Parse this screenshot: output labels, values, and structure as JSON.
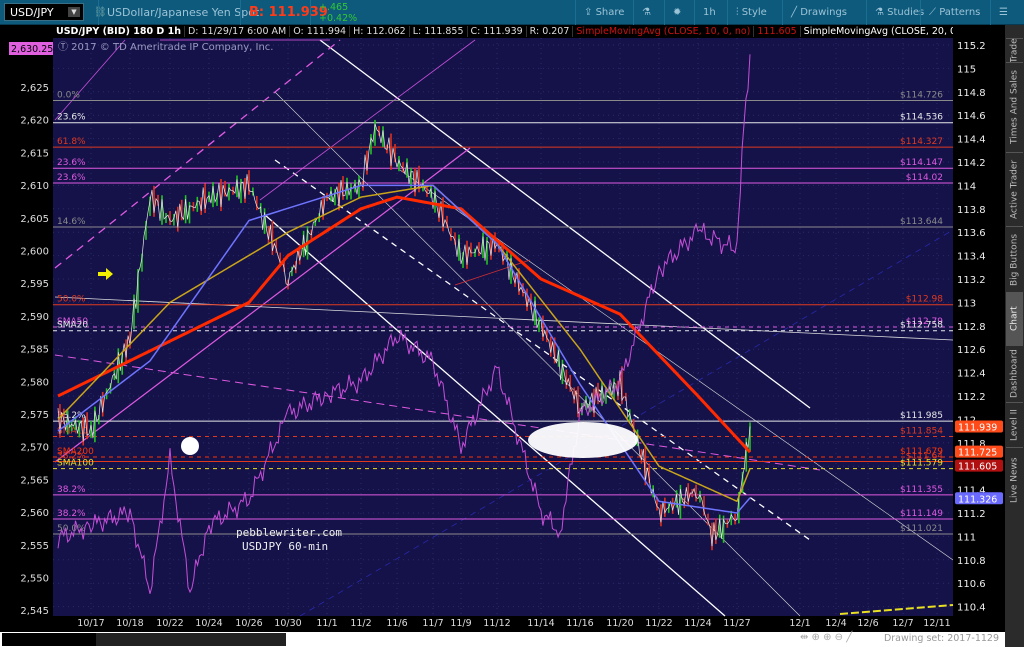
{
  "toolbar": {
    "symbol": "USD/JPY",
    "description": "USDollar/Japanese Yen Spot",
    "bid": "B: 111.939",
    "change": "+.465",
    "change_pct": "+0.42%",
    "share": "Share",
    "timeframe": "1h",
    "style": "Style",
    "drawings": "Drawings",
    "studies": "Studies",
    "patterns": "Patterns"
  },
  "info": {
    "title": "USD/JPY (BID) 180 D 1h",
    "date": "D: 11/29/17 6:00 AM",
    "open": "O: 111.994",
    "high": "H: 112.062",
    "low": "L: 111.855",
    "close": "C: 111.939",
    "range": "R: 0.207",
    "sma10_label": "SimpleMovingAvg (CLOSE, 10, 0, no)",
    "sma10_value": "111.605",
    "sma20_label": "SimpleMovingAvg (CLOSE, 20, 0, no)",
    "more": "..."
  },
  "copyright": "2017 © TD Ameritrade IP Company, Inc.",
  "annotation": [
    "pebblewriter.com",
    "USDJPY 60-min"
  ],
  "side_tabs": [
    "Trade",
    "Times And Sales",
    "Active Trader",
    "Big Buttons",
    "Chart",
    "Dashboard",
    "Level II",
    "Live News"
  ],
  "drawing_set": "Drawing set: 2017-1129",
  "colors": {
    "background": "#15124a",
    "toolbar": "#0e5a7c",
    "up": "#22c322",
    "down": "#e0301e",
    "spx": "#c44fd6",
    "sma_red": "#ff2a00",
    "sma_yellow": "#c9a419",
    "sma_blue": "#6f74ff",
    "sma_white": "#e8e8e8"
  },
  "chart_data": {
    "type": "line",
    "x_ticks": [
      "10/17",
      "10/18",
      "10/22",
      "10/24",
      "10/26",
      "10/30",
      "11/1",
      "11/2",
      "11/6",
      "11/7",
      "11/9",
      "11/12",
      "11/14",
      "11/16",
      "11/20",
      "11/22",
      "11/24",
      "11/27",
      "12/1",
      "12/4",
      "12/6",
      "12/7",
      "12/11"
    ],
    "right_axis": {
      "ticks": [
        "115.2",
        "115",
        "114.8",
        "114.6",
        "114.4",
        "114.2",
        "114",
        "113.8",
        "113.6",
        "113.4",
        "113.2",
        "113",
        "112.8",
        "112.6",
        "112.4",
        "112.2",
        "112",
        "111.8",
        "111.6",
        "111.4",
        "111.2",
        "111",
        "110.8",
        "110.6",
        "110.4"
      ],
      "range": [
        110.4,
        115.2
      ]
    },
    "left_axis": {
      "ticks": [
        "2,625",
        "2,620",
        "2,615",
        "2,610",
        "2,605",
        "2,600",
        "2,595",
        "2,590",
        "2,585",
        "2,580",
        "2,575",
        "2,570",
        "2,565",
        "2,560",
        "2,555",
        "2,550",
        "2,545"
      ],
      "range": [
        2545,
        2625
      ]
    },
    "series": [
      {
        "name": "USD/JPY",
        "axis": "right",
        "x": [
          "10/16",
          "10/17",
          "10/18",
          "10/19",
          "10/22",
          "10/24",
          "10/26",
          "10/30",
          "11/1",
          "11/2",
          "11/3",
          "11/6",
          "11/7",
          "11/9",
          "11/12",
          "11/14",
          "11/16",
          "11/20",
          "11/22",
          "11/24",
          "11/26",
          "11/27",
          "11/29"
        ],
        "values": [
          112.0,
          111.9,
          112.7,
          113.9,
          113.7,
          113.9,
          114.0,
          113.2,
          113.9,
          114.0,
          114.5,
          114.2,
          113.9,
          113.4,
          113.5,
          112.8,
          112.1,
          112.3,
          111.2,
          111.4,
          111.0,
          111.2,
          111.94
        ]
      },
      {
        "name": "SMA200",
        "axis": "right",
        "x": [
          "10/16",
          "10/26",
          "10/30",
          "11/2",
          "11/6",
          "11/9",
          "11/14",
          "11/20",
          "11/24",
          "11/29"
        ],
        "values": [
          112.2,
          113.0,
          113.4,
          113.8,
          113.9,
          113.8,
          113.2,
          112.9,
          112.2,
          111.72
        ]
      },
      {
        "name": "SMA100",
        "axis": "right",
        "x": [
          "10/16",
          "10/22",
          "10/30",
          "11/2",
          "11/7",
          "11/12",
          "11/16",
          "11/22",
          "11/27",
          "11/29"
        ],
        "values": [
          112.0,
          113.0,
          113.6,
          113.9,
          114.0,
          113.5,
          112.6,
          111.6,
          111.3,
          111.58
        ]
      },
      {
        "name": "SMA50",
        "axis": "right",
        "x": [
          "10/16",
          "10/19",
          "10/26",
          "11/2",
          "11/7",
          "11/12",
          "11/16",
          "11/22",
          "11/27",
          "11/29"
        ],
        "values": [
          111.9,
          112.5,
          113.7,
          114.0,
          114.0,
          113.5,
          112.3,
          111.3,
          111.2,
          111.33
        ]
      },
      {
        "name": "SPX",
        "axis": "left",
        "x": [
          "10/16",
          "10/17",
          "10/18",
          "10/19",
          "10/22",
          "10/23",
          "10/24",
          "10/26",
          "10/30",
          "11/1",
          "11/2",
          "11/6",
          "11/7",
          "11/9",
          "11/12",
          "11/14",
          "11/15",
          "11/16",
          "11/20",
          "11/22",
          "11/24",
          "11/27",
          "11/28",
          "11/29"
        ],
        "values": [
          2556,
          2558,
          2560,
          2548,
          2568,
          2548,
          2558,
          2562,
          2575,
          2578,
          2580,
          2587,
          2583,
          2570,
          2582,
          2560,
          2557,
          2575,
          2580,
          2597,
          2603,
          2600,
          2615,
          2630
        ]
      }
    ],
    "levels": [
      {
        "price": 114.726,
        "label": "0.0%",
        "value": "$114.726",
        "color": "#8a8a8a"
      },
      {
        "price": 114.536,
        "label": "23.6%",
        "value": "$114.536",
        "color": "#e8e8e8"
      },
      {
        "price": 114.327,
        "label": "61.8%",
        "value": "$114.327",
        "color": "#e03a1e"
      },
      {
        "price": 114.147,
        "label": "23.6%",
        "value": "$114.147",
        "color": "#e05ae0"
      },
      {
        "price": 114.02,
        "label": "23.6%",
        "value": "$114.02",
        "color": "#e05ae0"
      },
      {
        "price": 113.644,
        "label": "14.6%",
        "value": "$113.644",
        "color": "#8a8a8a"
      },
      {
        "price": 112.98,
        "label": "50.0%",
        "value": "$112.98",
        "color": "#e03a1e"
      },
      {
        "price": 112.79,
        "label": "SMA50",
        "value": "$112.79",
        "color": "#e05ae0",
        "dashed": true
      },
      {
        "price": 112.758,
        "label": "SMA20",
        "value": "$112.758",
        "color": "#e8e8e8",
        "dashed": true
      },
      {
        "price": 111.985,
        "label": "38.2%",
        "value": "$111.985",
        "color": "#e8e8e8"
      },
      {
        "price": 111.854,
        "label": "SMA10",
        "value": "$111.854",
        "color": "#e03a1e",
        "dashed": true
      },
      {
        "price": 111.679,
        "label": "SMA200",
        "value": "$111.679",
        "color": "#ff3300",
        "dashed": true
      },
      {
        "price": 111.64,
        "label": "38.2%",
        "value": "$111.64",
        "color": "#e03a1e"
      },
      {
        "price": 111.579,
        "label": "SMA100",
        "value": "$111.579",
        "color": "#e8e020",
        "dashed": true
      },
      {
        "price": 111.355,
        "label": "38.2%",
        "value": "$111.355",
        "color": "#e05ae0"
      },
      {
        "price": 111.149,
        "label": "38.2%",
        "value": "$111.149",
        "color": "#e05ae0"
      },
      {
        "price": 111.021,
        "label": "50.0%",
        "value": "$111.021",
        "color": "#8a8a8a"
      }
    ],
    "badges": [
      {
        "value": "111.939",
        "color": "#ff4a1a",
        "price": 111.939
      },
      {
        "value": "111.725",
        "color": "#ff4a1a",
        "price": 111.725
      },
      {
        "value": "111.605",
        "color": "#b01010",
        "price": 111.605
      },
      {
        "value": "111.326",
        "color": "#6a6aff",
        "price": 111.326
      }
    ],
    "left_badge": {
      "value": "2,630.25",
      "color": "#e060e0"
    }
  }
}
